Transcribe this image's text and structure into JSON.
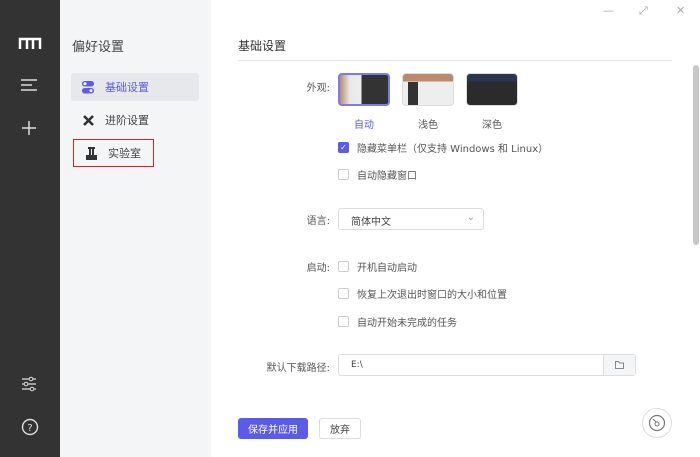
{
  "window": {
    "minimize": "—",
    "maximize": "⤢",
    "close": "✕"
  },
  "nav": {
    "title": "偏好设置",
    "items": [
      {
        "label": "基础设置"
      },
      {
        "label": "进阶设置"
      },
      {
        "label": "实验室"
      }
    ]
  },
  "main": {
    "title": "基础设置",
    "appearance": {
      "label": "外观:",
      "options": [
        {
          "label": "自动"
        },
        {
          "label": "浅色"
        },
        {
          "label": "深色"
        }
      ],
      "selected": "自动"
    },
    "hide_menu": {
      "label": "隐藏菜单栏（仅支持 Windows 和 Linux）",
      "checked": true
    },
    "auto_hide": {
      "label": "自动隐藏窗口",
      "checked": false
    },
    "language": {
      "label": "语言:",
      "value": "简体中文"
    },
    "startup": {
      "label": "启动:",
      "options": [
        {
          "label": "开机自动启动",
          "checked": false
        },
        {
          "label": "恢复上次退出时窗口的大小和位置",
          "checked": false
        },
        {
          "label": "自动开始未完成的任务",
          "checked": false
        }
      ]
    },
    "path": {
      "label": "默认下载路径:",
      "value": "E:\\"
    },
    "save_label": "保存并应用",
    "discard_label": "放弃"
  },
  "colors": {
    "accent": "#5b5bea",
    "dock": "#333333"
  }
}
